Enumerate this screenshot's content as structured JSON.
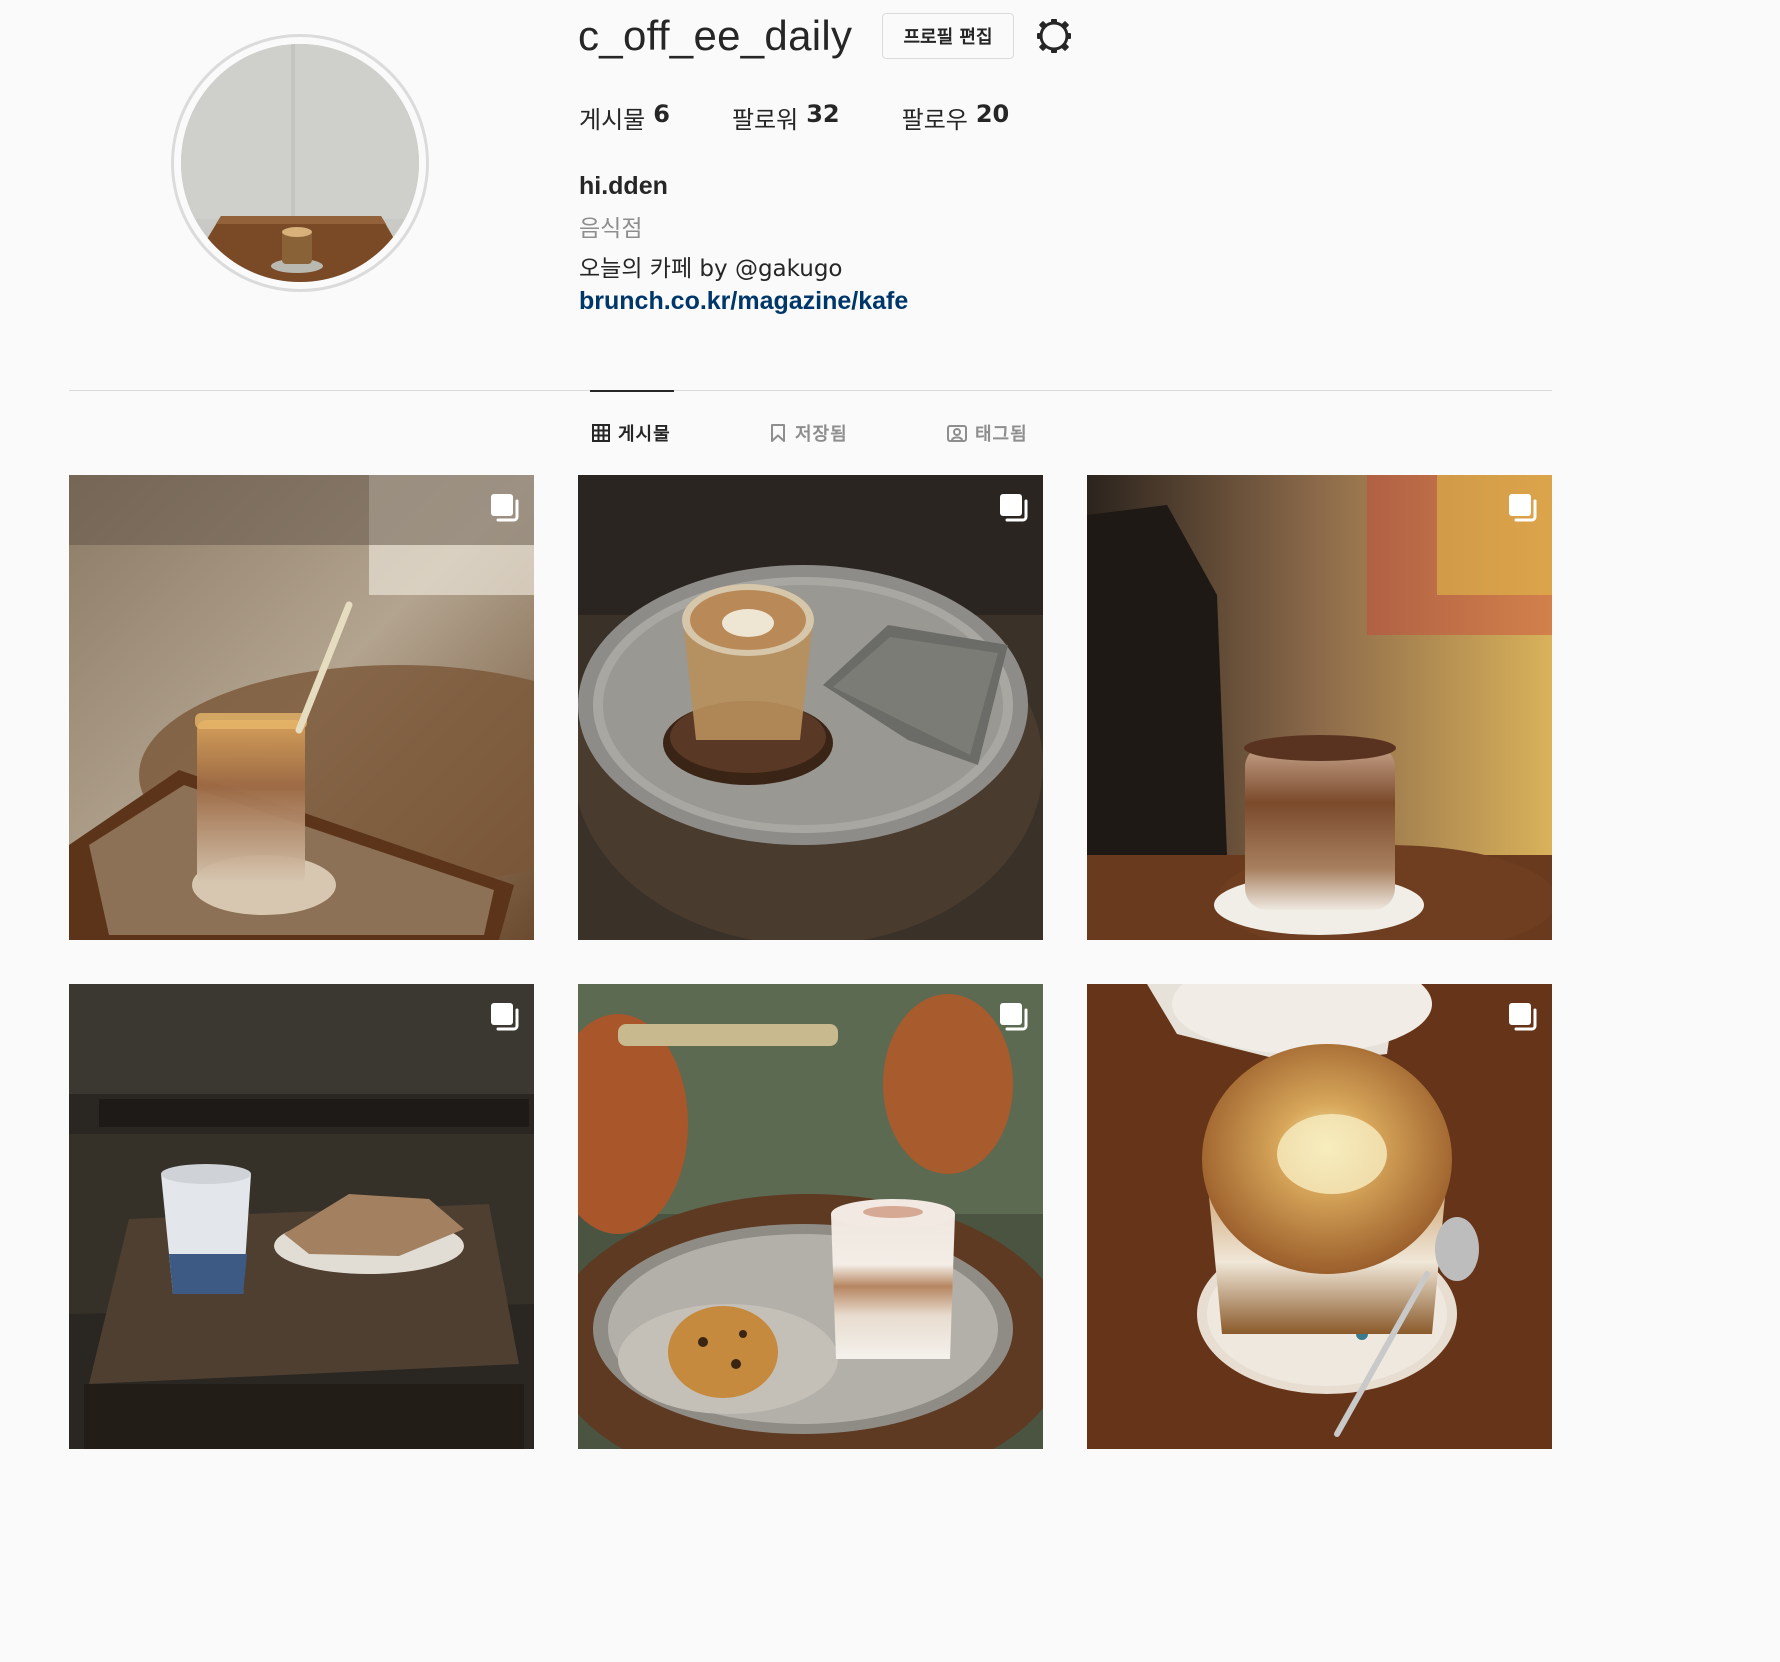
{
  "profile": {
    "username": "c_off_ee_daily",
    "edit_button": "프로필 편집",
    "display_name": "hi.dden",
    "category": "음식점",
    "bio": "오늘의 카페 by @gakugo",
    "link": "brunch.co.kr/magazine/kafe",
    "link_color": "#00376b"
  },
  "stats": [
    {
      "label": "게시물",
      "value": "6"
    },
    {
      "label": "팔로워",
      "value": "32"
    },
    {
      "label": "팔로우",
      "value": "20"
    }
  ],
  "tabs": [
    {
      "label": "게시물",
      "icon": "grid-icon",
      "active": true
    },
    {
      "label": "저장됨",
      "icon": "bookmark-icon",
      "active": false
    },
    {
      "label": "태그됨",
      "icon": "tagged-icon",
      "active": false
    }
  ],
  "posts": [
    {
      "subject": "iced latte in tall glass with straw on wooden tray",
      "multi_photo": true
    },
    {
      "subject": "latte art in glass on metal tray with napkin",
      "multi_photo": true
    },
    {
      "subject": "layered iced coffee with cocoa powder on doily",
      "multi_photo": true
    },
    {
      "subject": "iced coffee in paper cup with pastry on plate",
      "multi_photo": true
    },
    {
      "subject": "layered latte with cookie on metal tray",
      "multi_photo": true
    },
    {
      "subject": "coffee topped with cream and cinnamon, spoon",
      "multi_photo": true
    }
  ]
}
